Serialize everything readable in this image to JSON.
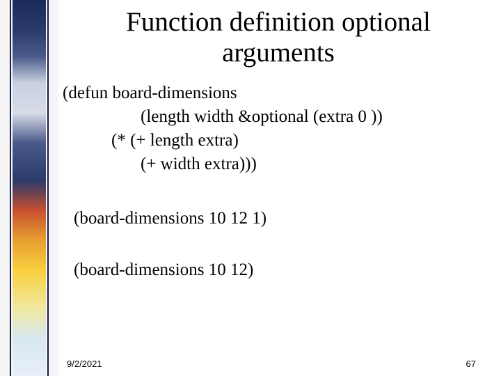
{
  "title": "Function definition optional arguments",
  "code": {
    "line1": "(defun  board-dimensions",
    "line2": "(length width &optional (extra  0 ))",
    "line3": "(*  (+ length extra)",
    "line4": "(+ width extra)))"
  },
  "calls": {
    "call1": "(board-dimensions 10 12 1)",
    "call2": "(board-dimensions 10 12)"
  },
  "footer": {
    "date": "9/2/2021",
    "page": "67"
  }
}
